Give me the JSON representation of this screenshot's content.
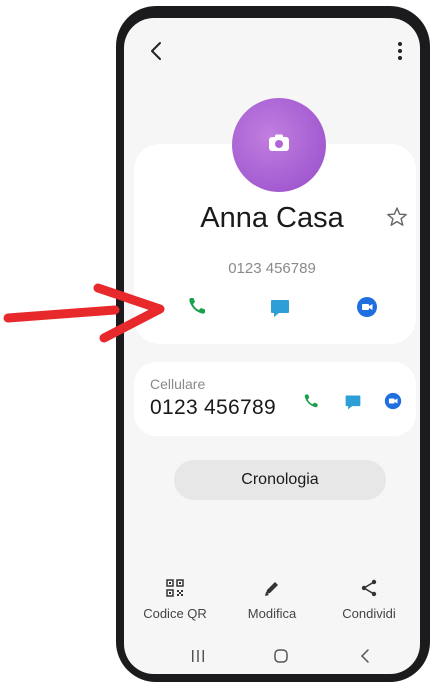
{
  "contact": {
    "name": "Anna Casa",
    "phone_header": "0123 456789"
  },
  "phone_card": {
    "label": "Cellulare",
    "number": "0123 456789"
  },
  "history_button": "Cronologia",
  "bottom_actions": [
    {
      "label": "Codice QR",
      "icon": "qr-code-icon"
    },
    {
      "label": "Modifica",
      "icon": "pencil-icon"
    },
    {
      "label": "Condividi",
      "icon": "share-icon"
    }
  ],
  "colors": {
    "avatar": "#a35bd0",
    "call_green": "#1a9f4c",
    "message_blue": "#2e9fd6",
    "video_blue": "#1f6fe0",
    "annotation_arrow": "#e8292b"
  },
  "navbar_icons": [
    "recents-icon",
    "home-icon",
    "back-nav-icon"
  ]
}
